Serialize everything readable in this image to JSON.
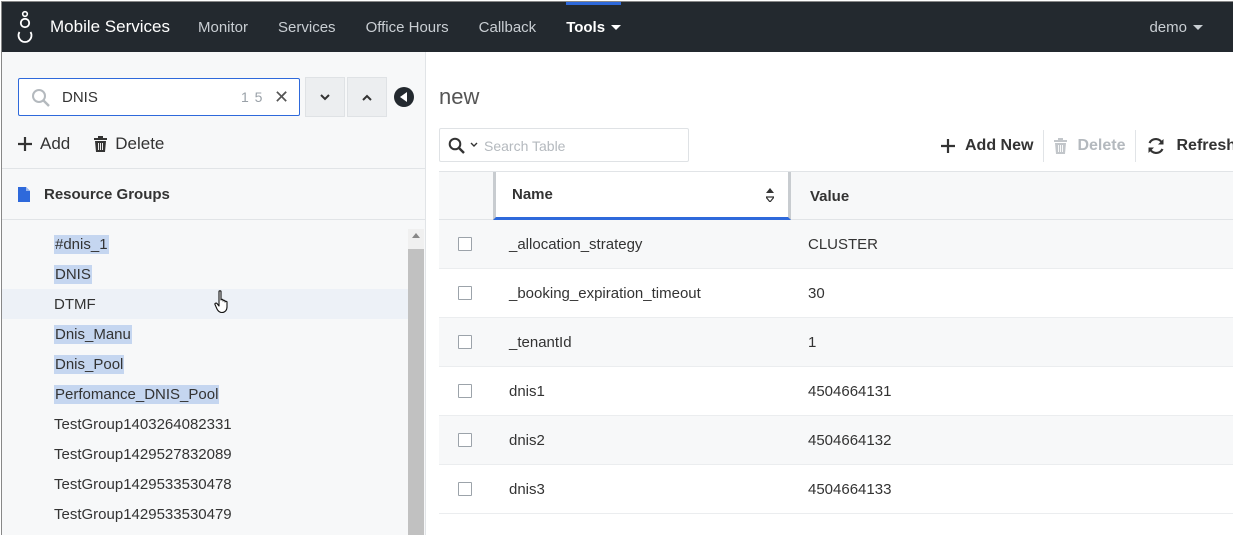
{
  "app": {
    "title": "Mobile Services"
  },
  "nav": {
    "items": [
      {
        "label": "Monitor",
        "active": false
      },
      {
        "label": "Services",
        "active": false
      },
      {
        "label": "Office Hours",
        "active": false
      },
      {
        "label": "Callback",
        "active": false
      },
      {
        "label": "Tools",
        "active": true
      }
    ],
    "user": "demo"
  },
  "sidebar": {
    "search": {
      "value": "DNIS",
      "match_count": "1 5"
    },
    "add_label": "Add",
    "delete_label": "Delete",
    "section_title": "Resource Groups",
    "items": [
      {
        "label": "#dnis_1",
        "highlighted": true
      },
      {
        "label": "DNIS",
        "highlighted": true
      },
      {
        "label": "DTMF",
        "highlighted": false
      },
      {
        "label": "Dnis_Manu",
        "highlighted": true
      },
      {
        "label": "Dnis_Pool",
        "highlighted": true
      },
      {
        "label": "Perfomance_DNIS_Pool",
        "highlighted": true
      },
      {
        "label": "TestGroup1403264082331",
        "highlighted": false
      },
      {
        "label": "TestGroup1429527832089",
        "highlighted": false
      },
      {
        "label": "TestGroup1429533530478",
        "highlighted": false
      },
      {
        "label": "TestGroup1429533530479",
        "highlighted": false
      }
    ]
  },
  "main": {
    "title": "new",
    "search_placeholder": "Search Table",
    "add_new_label": "Add New",
    "delete_label": "Delete",
    "refresh_label": "Refresh",
    "table": {
      "headers": {
        "name": "Name",
        "value": "Value"
      },
      "rows": [
        {
          "name": "_allocation_strategy",
          "value": "CLUSTER"
        },
        {
          "name": "_booking_expiration_timeout",
          "value": "30"
        },
        {
          "name": "_tenantId",
          "value": "1"
        },
        {
          "name": "dnis1",
          "value": "4504664131"
        },
        {
          "name": "dnis2",
          "value": "4504664132"
        },
        {
          "name": "dnis3",
          "value": "4504664133"
        }
      ]
    }
  },
  "colors": {
    "navbar": "#23292f",
    "accent": "#2e69db",
    "highlight": "#c5d6f0"
  }
}
